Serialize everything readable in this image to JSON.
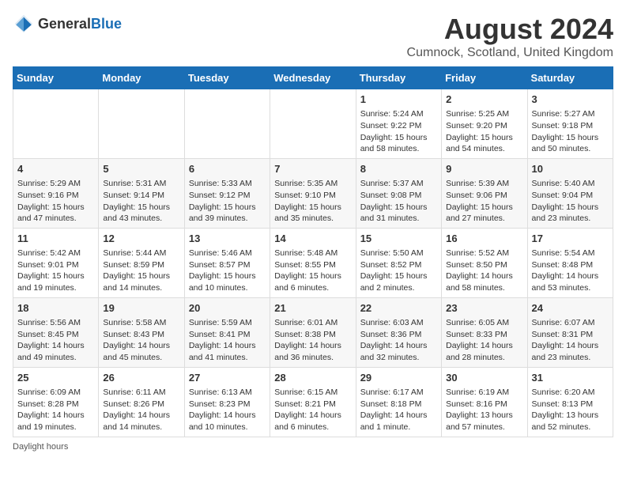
{
  "header": {
    "title": "August 2024",
    "subtitle": "Cumnock, Scotland, United Kingdom",
    "logo_general": "General",
    "logo_blue": "Blue"
  },
  "weekdays": [
    "Sunday",
    "Monday",
    "Tuesday",
    "Wednesday",
    "Thursday",
    "Friday",
    "Saturday"
  ],
  "rows": [
    [
      {
        "day": "",
        "info": ""
      },
      {
        "day": "",
        "info": ""
      },
      {
        "day": "",
        "info": ""
      },
      {
        "day": "",
        "info": ""
      },
      {
        "day": "1",
        "info": "Sunrise: 5:24 AM\nSunset: 9:22 PM\nDaylight: 15 hours and 58 minutes."
      },
      {
        "day": "2",
        "info": "Sunrise: 5:25 AM\nSunset: 9:20 PM\nDaylight: 15 hours and 54 minutes."
      },
      {
        "day": "3",
        "info": "Sunrise: 5:27 AM\nSunset: 9:18 PM\nDaylight: 15 hours and 50 minutes."
      }
    ],
    [
      {
        "day": "4",
        "info": "Sunrise: 5:29 AM\nSunset: 9:16 PM\nDaylight: 15 hours and 47 minutes."
      },
      {
        "day": "5",
        "info": "Sunrise: 5:31 AM\nSunset: 9:14 PM\nDaylight: 15 hours and 43 minutes."
      },
      {
        "day": "6",
        "info": "Sunrise: 5:33 AM\nSunset: 9:12 PM\nDaylight: 15 hours and 39 minutes."
      },
      {
        "day": "7",
        "info": "Sunrise: 5:35 AM\nSunset: 9:10 PM\nDaylight: 15 hours and 35 minutes."
      },
      {
        "day": "8",
        "info": "Sunrise: 5:37 AM\nSunset: 9:08 PM\nDaylight: 15 hours and 31 minutes."
      },
      {
        "day": "9",
        "info": "Sunrise: 5:39 AM\nSunset: 9:06 PM\nDaylight: 15 hours and 27 minutes."
      },
      {
        "day": "10",
        "info": "Sunrise: 5:40 AM\nSunset: 9:04 PM\nDaylight: 15 hours and 23 minutes."
      }
    ],
    [
      {
        "day": "11",
        "info": "Sunrise: 5:42 AM\nSunset: 9:01 PM\nDaylight: 15 hours and 19 minutes."
      },
      {
        "day": "12",
        "info": "Sunrise: 5:44 AM\nSunset: 8:59 PM\nDaylight: 15 hours and 14 minutes."
      },
      {
        "day": "13",
        "info": "Sunrise: 5:46 AM\nSunset: 8:57 PM\nDaylight: 15 hours and 10 minutes."
      },
      {
        "day": "14",
        "info": "Sunrise: 5:48 AM\nSunset: 8:55 PM\nDaylight: 15 hours and 6 minutes."
      },
      {
        "day": "15",
        "info": "Sunrise: 5:50 AM\nSunset: 8:52 PM\nDaylight: 15 hours and 2 minutes."
      },
      {
        "day": "16",
        "info": "Sunrise: 5:52 AM\nSunset: 8:50 PM\nDaylight: 14 hours and 58 minutes."
      },
      {
        "day": "17",
        "info": "Sunrise: 5:54 AM\nSunset: 8:48 PM\nDaylight: 14 hours and 53 minutes."
      }
    ],
    [
      {
        "day": "18",
        "info": "Sunrise: 5:56 AM\nSunset: 8:45 PM\nDaylight: 14 hours and 49 minutes."
      },
      {
        "day": "19",
        "info": "Sunrise: 5:58 AM\nSunset: 8:43 PM\nDaylight: 14 hours and 45 minutes."
      },
      {
        "day": "20",
        "info": "Sunrise: 5:59 AM\nSunset: 8:41 PM\nDaylight: 14 hours and 41 minutes."
      },
      {
        "day": "21",
        "info": "Sunrise: 6:01 AM\nSunset: 8:38 PM\nDaylight: 14 hours and 36 minutes."
      },
      {
        "day": "22",
        "info": "Sunrise: 6:03 AM\nSunset: 8:36 PM\nDaylight: 14 hours and 32 minutes."
      },
      {
        "day": "23",
        "info": "Sunrise: 6:05 AM\nSunset: 8:33 PM\nDaylight: 14 hours and 28 minutes."
      },
      {
        "day": "24",
        "info": "Sunrise: 6:07 AM\nSunset: 8:31 PM\nDaylight: 14 hours and 23 minutes."
      }
    ],
    [
      {
        "day": "25",
        "info": "Sunrise: 6:09 AM\nSunset: 8:28 PM\nDaylight: 14 hours and 19 minutes."
      },
      {
        "day": "26",
        "info": "Sunrise: 6:11 AM\nSunset: 8:26 PM\nDaylight: 14 hours and 14 minutes."
      },
      {
        "day": "27",
        "info": "Sunrise: 6:13 AM\nSunset: 8:23 PM\nDaylight: 14 hours and 10 minutes."
      },
      {
        "day": "28",
        "info": "Sunrise: 6:15 AM\nSunset: 8:21 PM\nDaylight: 14 hours and 6 minutes."
      },
      {
        "day": "29",
        "info": "Sunrise: 6:17 AM\nSunset: 8:18 PM\nDaylight: 14 hours and 1 minute."
      },
      {
        "day": "30",
        "info": "Sunrise: 6:19 AM\nSunset: 8:16 PM\nDaylight: 13 hours and 57 minutes."
      },
      {
        "day": "31",
        "info": "Sunrise: 6:20 AM\nSunset: 8:13 PM\nDaylight: 13 hours and 52 minutes."
      }
    ]
  ],
  "footer": {
    "note": "Daylight hours"
  }
}
